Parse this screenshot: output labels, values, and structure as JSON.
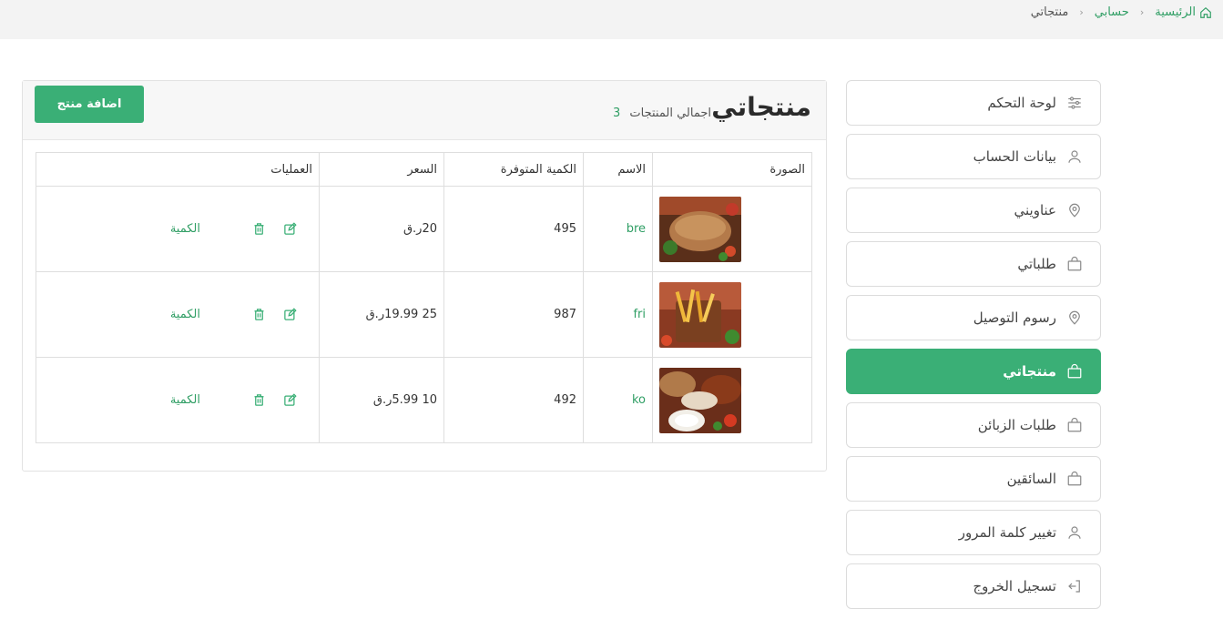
{
  "breadcrumb": {
    "home": "الرئيسية",
    "account": "حسابي",
    "current": "منتجاتي"
  },
  "sidebar": {
    "items": [
      {
        "label": "لوحة التحكم",
        "icon": "sliders-icon",
        "active": false
      },
      {
        "label": "بيانات الحساب",
        "icon": "user-icon",
        "active": false
      },
      {
        "label": "عناويني",
        "icon": "map-pin-icon",
        "active": false
      },
      {
        "label": "طلباتي",
        "icon": "bag-icon",
        "active": false
      },
      {
        "label": "رسوم التوصيل",
        "icon": "map-pin-icon",
        "active": false
      },
      {
        "label": "منتجاتي",
        "icon": "bag-icon",
        "active": true
      },
      {
        "label": "طلبات الزبائن",
        "icon": "bag-icon",
        "active": false
      },
      {
        "label": "السائقين",
        "icon": "bag-icon",
        "active": false
      },
      {
        "label": "تغيير كلمة المرور",
        "icon": "user-icon",
        "active": false
      },
      {
        "label": "تسجيل الخروج",
        "icon": "logout-icon",
        "active": false
      }
    ]
  },
  "main": {
    "title": "منتجاتي",
    "total_label": "اجمالي المنتجات",
    "total_count": "3",
    "add_button": "اضافة منتج"
  },
  "table": {
    "headers": {
      "image": "الصورة",
      "name": "الاسم",
      "quantity": "الكمية المتوفرة",
      "price": "السعر",
      "operations": "العمليات"
    },
    "rows": [
      {
        "name": "bre",
        "quantity": "495",
        "price": "20ر.ق",
        "qty_link": "الكمية",
        "image": "burger-photo"
      },
      {
        "name": "fri",
        "quantity": "987",
        "price": "25 19.99ر.ق",
        "qty_link": "الكمية",
        "image": "fries-photo"
      },
      {
        "name": "ko",
        "quantity": "492",
        "price": "10 5.99ر.ق",
        "qty_link": "الكمية",
        "image": "grill-photo"
      }
    ]
  },
  "colors": {
    "accent": "#3aaf76",
    "link": "#2f9e64"
  }
}
